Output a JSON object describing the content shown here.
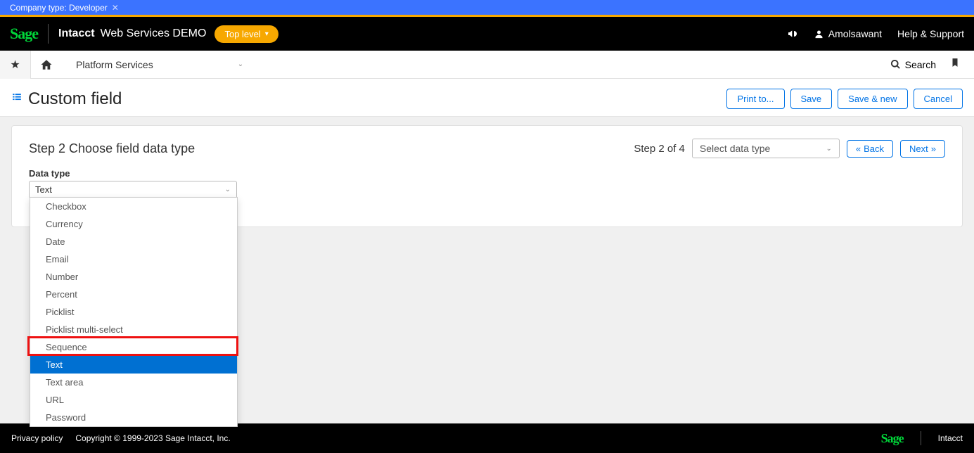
{
  "top_bar": {
    "label": "Company type: Developer"
  },
  "header": {
    "brand": "Sage",
    "product": "Intacct",
    "env": "Web Services DEMO",
    "level_pill": "Top level",
    "user": "Amolsawant",
    "help": "Help & Support"
  },
  "nav": {
    "module": "Platform Services",
    "search": "Search"
  },
  "page": {
    "title": "Custom field",
    "actions": {
      "print": "Print to...",
      "save": "Save",
      "save_new": "Save & new",
      "cancel": "Cancel"
    }
  },
  "step": {
    "title": "Step 2 Choose field data type",
    "counter": "Step 2 of 4",
    "select_placeholder": "Select data type",
    "back": "Back",
    "next": "Next"
  },
  "datatype": {
    "label": "Data type",
    "value": "Text",
    "options": [
      "Checkbox",
      "Currency",
      "Date",
      "Email",
      "Number",
      "Percent",
      "Picklist",
      "Picklist multi-select",
      "Sequence",
      "Text",
      "Text area",
      "URL",
      "Password"
    ],
    "selected_index": 9
  },
  "footer": {
    "privacy": "Privacy policy",
    "copyright": "Copyright © 1999-2023 Sage Intacct, Inc.",
    "brand": "Sage",
    "product": "Intacct"
  }
}
